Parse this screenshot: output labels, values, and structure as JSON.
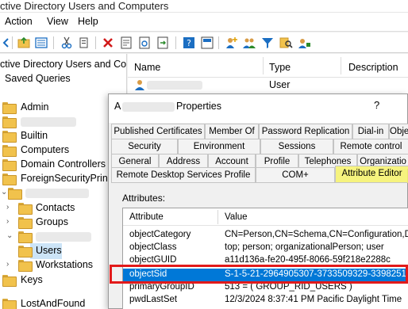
{
  "window": {
    "title": "ctive Directory Users and Computers"
  },
  "menu": [
    "Action",
    "View",
    "Help"
  ],
  "toolbar": {
    "icons": [
      "back-icon",
      "up-folder-icon",
      "details-view-icon",
      "cut-icon",
      "copy-icon",
      "delete-icon",
      "properties-icon",
      "refresh-icon",
      "export-icon",
      "help-icon",
      "console-icon",
      "add-user-icon",
      "add-group-icon",
      "filter-icon",
      "find-icon",
      "add-to-group-icon"
    ]
  },
  "tree": {
    "root": "ctive Directory Users and Co",
    "items": [
      "Saved Queries",
      "Admin",
      "Builtin",
      "Computers",
      "Domain Controllers",
      "ForeignSecurityPrinc",
      "Contacts",
      "Groups",
      "Users",
      "Workstations",
      "Keys",
      "LostAndFound"
    ]
  },
  "list": {
    "columns": [
      "Name",
      "Type",
      "Description"
    ],
    "rows": [
      {
        "type": "User"
      }
    ]
  },
  "dialog": {
    "title_prefix": "A",
    "title_suffix": "Properties",
    "help": "?",
    "tabs_row1": [
      "Published Certificates",
      "Member Of",
      "Password Replication",
      "Dial-in",
      "Obje"
    ],
    "tabs_row2": [
      "Security",
      "Environment",
      "Sessions",
      "Remote control"
    ],
    "tabs_row3": [
      "General",
      "Address",
      "Account",
      "Profile",
      "Telephones",
      "Organizatio"
    ],
    "tabs_row4": [
      "Remote Desktop Services Profile",
      "COM+",
      "Attribute Editor"
    ],
    "attributes_label": "Attributes:",
    "grid": {
      "columns": [
        "Attribute",
        "Value"
      ],
      "rows": [
        {
          "attr": "objectCategory",
          "value": "CN=Person,CN=Schema,CN=Configuration,D"
        },
        {
          "attr": "objectClass",
          "value": "top; person; organizationalPerson; user"
        },
        {
          "attr": "objectGUID",
          "value": "a11d136a-fe20-495f-8066-59f218e2288c"
        },
        {
          "attr": "objectSid",
          "value": "S-1-5-21-2964905307-3733509329-3398251"
        },
        {
          "attr": "primaryGroupID",
          "value": "513 = ( GROUP_RID_USERS )"
        },
        {
          "attr": "pwdLastSet",
          "value": "12/3/2024 8:37:41 PM Pacific Daylight Time"
        }
      ]
    }
  },
  "colors": {
    "selection": "#0078d7",
    "highlight_box": "#e21a1a",
    "marker": "#f7f36a"
  }
}
